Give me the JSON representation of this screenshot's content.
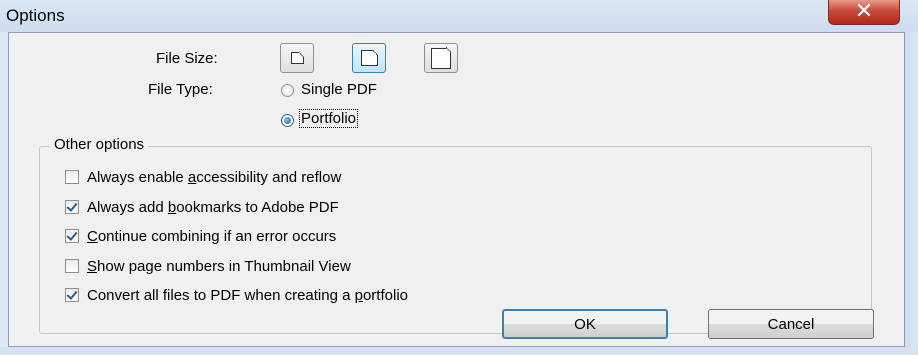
{
  "window": {
    "title": "Options",
    "close_glyph": "✕"
  },
  "file_size": {
    "label": "File Size:",
    "options": [
      "small-page-icon",
      "medium-page-icon",
      "large-page-icon"
    ],
    "selected_index": 1
  },
  "file_type": {
    "label": "File Type:",
    "options": [
      {
        "label": "Single PDF",
        "selected": false
      },
      {
        "label": "Portfolio",
        "selected": true
      }
    ]
  },
  "other_options": {
    "title": "Other options",
    "items": [
      {
        "label_pre": "Always enable ",
        "mnemonic": "a",
        "label_post": "ccessibility and reflow",
        "checked": false
      },
      {
        "label_pre": "Always add ",
        "mnemonic": "b",
        "label_post": "ookmarks to Adobe PDF",
        "checked": true
      },
      {
        "label_pre": "",
        "mnemonic": "C",
        "label_post": "ontinue combining if an error occurs",
        "checked": true
      },
      {
        "label_pre": "",
        "mnemonic": "S",
        "label_post": "how page numbers in Thumbnail View",
        "checked": false
      },
      {
        "label_pre": "Convert all files to PDF when creating a ",
        "mnemonic": "p",
        "label_post": "ortfolio",
        "checked": true
      }
    ]
  },
  "buttons": {
    "ok": "OK",
    "cancel": "Cancel"
  },
  "colors": {
    "accent": "#3c7fb1",
    "close_button": "#c8493a",
    "dialog_bg": "#f0f0f0"
  }
}
